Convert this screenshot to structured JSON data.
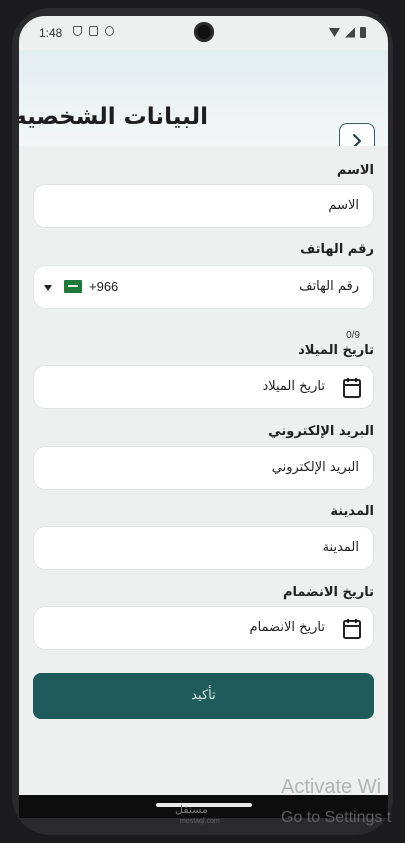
{
  "status_bar": {
    "time": "1:48",
    "left_icons": [
      "shield-icon",
      "sd-card-icon",
      "face-icon"
    ],
    "right_icons": [
      "wifi-icon",
      "signal-icon",
      "battery-icon"
    ]
  },
  "header": {
    "title": "البيانات الشخصيه",
    "back_icon": "chevron-right-icon"
  },
  "form": {
    "name": {
      "label": "الاسم",
      "placeholder": "الاسم"
    },
    "phone": {
      "label": "رقم الهاتف",
      "placeholder": "رقم الهاتف",
      "country_code": "+966",
      "flag_icon": "saudi-flag-icon",
      "counter": "0/9"
    },
    "birth_date": {
      "label": "تاريخ الميلاد",
      "placeholder": "تاريخ الميلاد",
      "icon": "calendar-icon"
    },
    "email": {
      "label": "البريد الإلكتروني",
      "placeholder": "البريد الإلكتروني"
    },
    "city": {
      "label": "المدينة",
      "placeholder": "المدينة"
    },
    "join_date": {
      "label": "تاريخ الانضمام",
      "placeholder": "تاريخ الانضمام",
      "icon": "calendar-icon"
    },
    "confirm_label": "تأكيد"
  },
  "watermark": {
    "logo": "مستقل",
    "logo_sub": "mostaql.com",
    "activate_title": "Activate Wi",
    "activate_sub": "Go to Settings t"
  },
  "colors": {
    "accent": "#1f5b5b",
    "background": "#eef0f0",
    "field": "#ffffff"
  }
}
